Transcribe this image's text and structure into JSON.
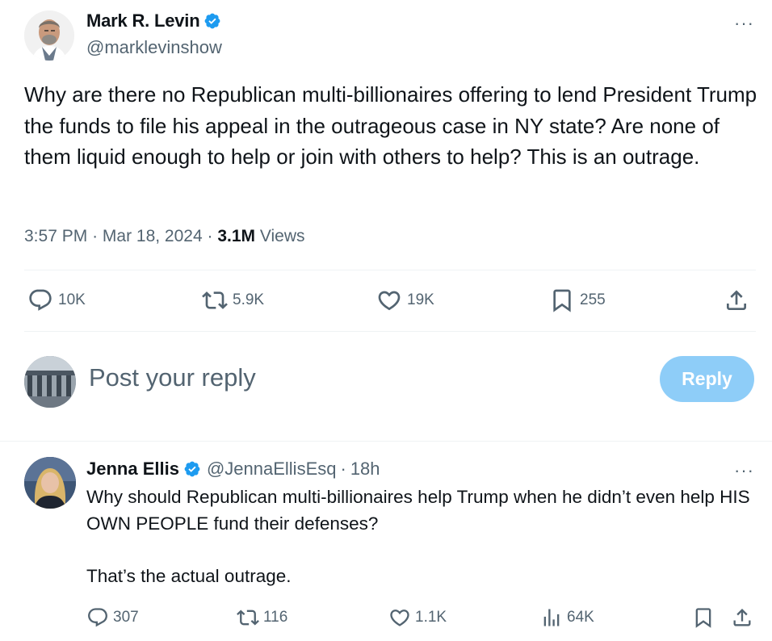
{
  "main_tweet": {
    "author_name": "Mark R. Levin",
    "author_handle": "@marklevinshow",
    "more_label": "···",
    "text": "Why are there no Republican multi-billionaires offering to lend President Trump the funds to file his appeal in the outrageous case in NY state?  Are none of them liquid enough to help or join with others to help?  This is an outrage.",
    "time": "3:57 PM",
    "separator": "·",
    "date": "Mar 18, 2024",
    "views_count": "3.1M",
    "views_label": "Views",
    "actions": {
      "replies": "10K",
      "reposts": "5.9K",
      "likes": "19K",
      "bookmarks": "255"
    }
  },
  "reply_box": {
    "placeholder": "Post your reply",
    "button_label": "Reply"
  },
  "reply_tweet": {
    "author_name": "Jenna Ellis",
    "author_handle": "@JennaEllisEsq",
    "separator": "·",
    "age": "18h",
    "more_label": "···",
    "paragraphs": [
      "Why should Republican multi-billionaires help Trump when he didn’t even help HIS OWN PEOPLE fund their defenses?",
      "That’s the actual outrage."
    ],
    "actions": {
      "replies": "307",
      "reposts": "116",
      "likes": "1.1K",
      "views": "64K"
    }
  },
  "colors": {
    "accent": "#1d9bf0",
    "reply_button_disabled": "#8ecdf8",
    "secondary_text": "#536471",
    "primary_text": "#0f1419",
    "divider": "#eff3f4"
  },
  "icons": [
    "verified-badge-icon",
    "more-icon",
    "reply-icon",
    "repost-icon",
    "like-icon",
    "bookmark-icon",
    "share-icon",
    "views-icon"
  ]
}
